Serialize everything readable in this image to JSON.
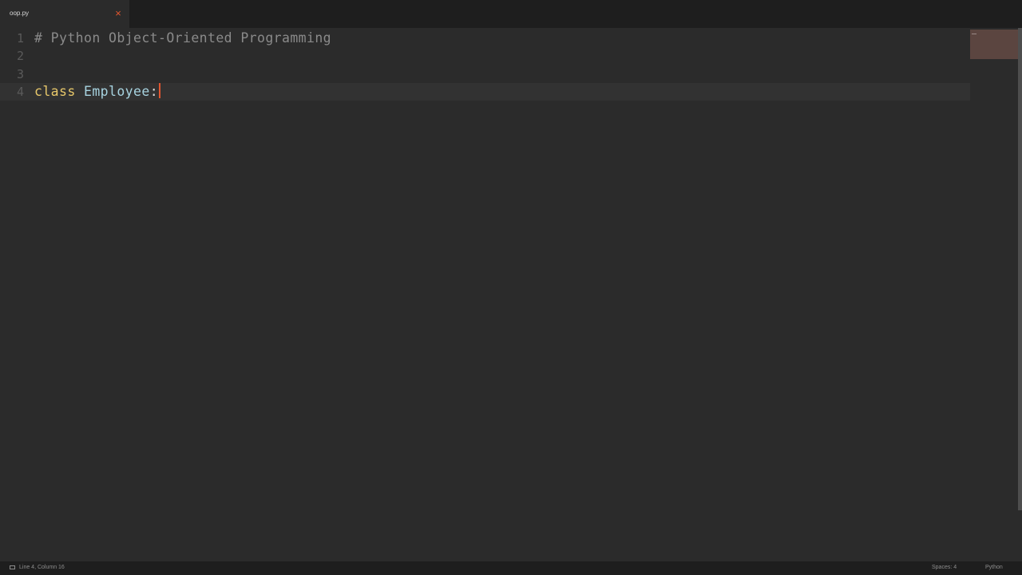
{
  "tab": {
    "title": "oop.py",
    "close_glyph": "×"
  },
  "editor": {
    "lines": [
      {
        "number": "1",
        "text": "# Python Object-Oriented Programming"
      },
      {
        "number": "2",
        "text": ""
      },
      {
        "number": "3",
        "text": ""
      },
      {
        "number": "4",
        "keyword": "class",
        "class_name": "Employee",
        "punct": ":"
      }
    ],
    "current_line": 4
  },
  "statusbar": {
    "position": "Line 4, Column 16",
    "indentation": "Spaces: 4",
    "syntax": "Python"
  },
  "colors": {
    "accent": "#e2562f",
    "background": "#2b2b2b",
    "keyword": "#e8c86a",
    "class_name": "#a7d3e0",
    "comment": "#8a8a8a"
  },
  "icons": {
    "tab_close": "close-icon",
    "status_panel": "panel-icon"
  }
}
